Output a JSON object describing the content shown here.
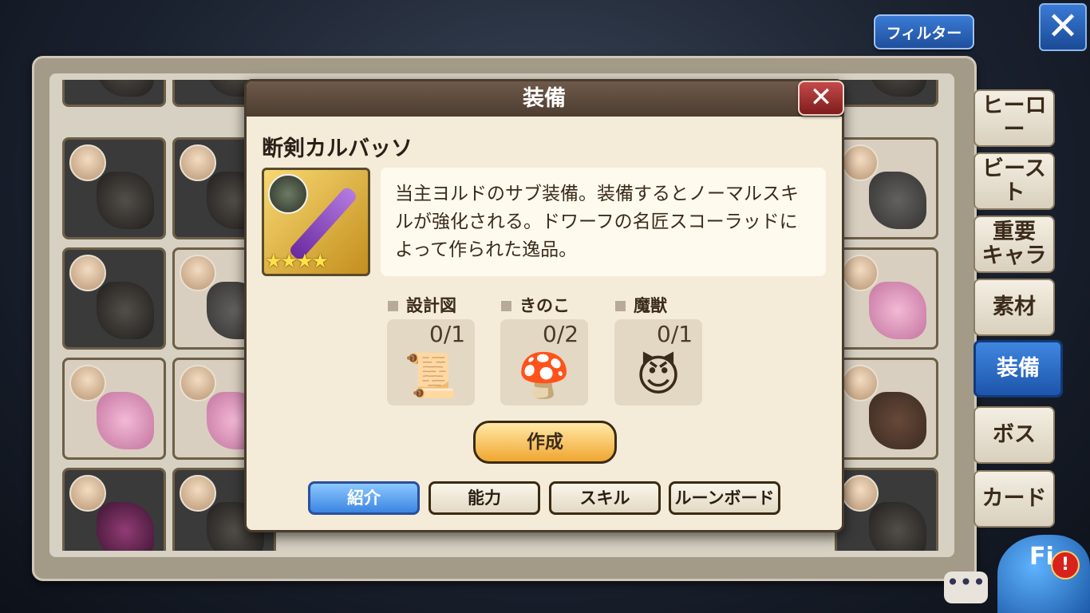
{
  "top": {
    "filter_label": "フィルター",
    "close_glyph": "✕"
  },
  "tabs": [
    {
      "label": "ヒーロー",
      "active": false
    },
    {
      "label": "ビースト",
      "active": false
    },
    {
      "label": "重要\nキャラ",
      "active": false
    },
    {
      "label": "素材",
      "active": false
    },
    {
      "label": "装備",
      "active": true
    },
    {
      "label": "ボス",
      "active": false
    },
    {
      "label": "カード",
      "active": false
    }
  ],
  "dialog": {
    "title": "装備",
    "close_glyph": "✕",
    "item_name": "断剣カルバッソ",
    "stars": "★★★★",
    "description": "当主ヨルドのサブ装備。装備するとノーマルスキルが強化される。ドワーフの名匠スコーラッドによって作られた逸品。",
    "materials": [
      {
        "label": "設計図",
        "count": "0/1",
        "icon": "blueprint-icon",
        "glyph": "📜"
      },
      {
        "label": "きのこ",
        "count": "0/2",
        "icon": "mushroom-icon",
        "glyph": "🍄"
      },
      {
        "label": "魔獣",
        "count": "0/1",
        "icon": "demon-icon",
        "glyph": "😈"
      }
    ],
    "make_label": "作成",
    "sub_tabs": [
      {
        "label": "紹介",
        "active": true
      },
      {
        "label": "能力",
        "active": false
      },
      {
        "label": "スキル",
        "active": false
      },
      {
        "label": "ルーンボード",
        "active": false
      }
    ]
  },
  "corner": {
    "chat_glyph": "•••",
    "fi_label": "Fi",
    "alert_glyph": "!"
  }
}
